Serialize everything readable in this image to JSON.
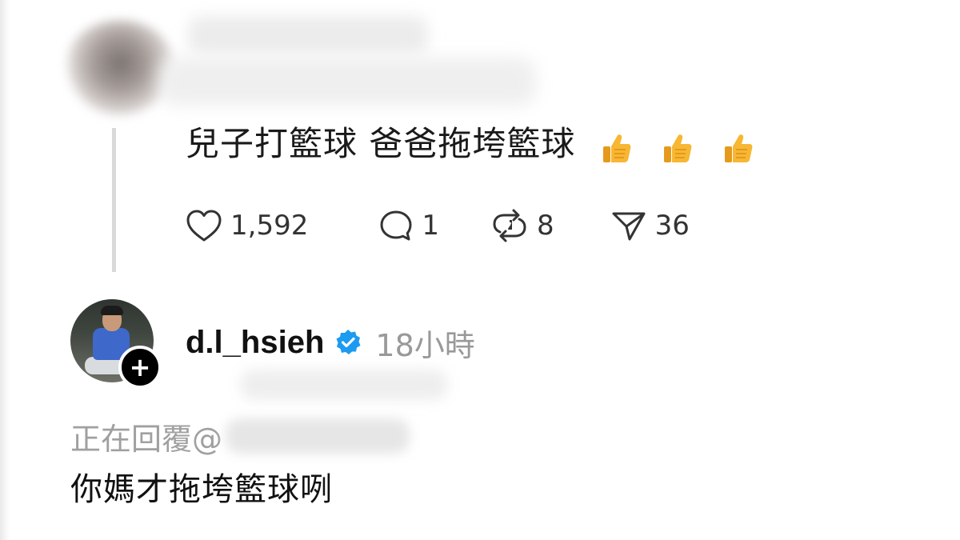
{
  "parent_post": {
    "text": "兒子打籃球 爸爸拖垮籃球",
    "reaction_emoji": [
      "thumbs-up",
      "thumbs-up",
      "thumbs-up"
    ],
    "actions": {
      "like_count": "1,592",
      "reply_count": "1",
      "repost_count": "8",
      "share_count": "36"
    }
  },
  "reply_post": {
    "username": "d.l_hsieh",
    "verified": true,
    "timestamp": "18小時",
    "replying_to_label": "正在回覆@",
    "text": "你媽才拖垮籃球咧"
  },
  "colors": {
    "text_primary": "#111111",
    "text_secondary": "#999999",
    "verified_blue": "#1d9bf0",
    "thread_line": "#d9d9d9",
    "thumbs_yellow": "#f7b733"
  },
  "icons": [
    "heart-icon",
    "comment-icon",
    "repost-icon",
    "share-icon",
    "verified-badge-icon",
    "plus-icon",
    "thumbs-up-icon"
  ]
}
